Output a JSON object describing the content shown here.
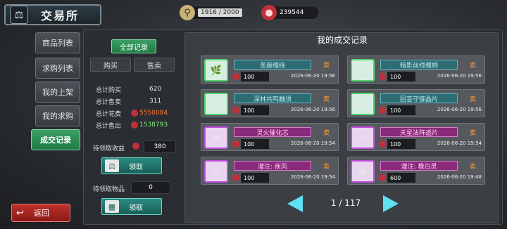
{
  "header": {
    "title": "交易所",
    "title_icon": "scale-icon",
    "capacity": "1916 / 2000",
    "gold": "239544"
  },
  "nav": {
    "tabs": [
      "商品列表",
      "求购列表",
      "我的上架",
      "我的求购",
      "成交记录"
    ],
    "active_index": 4,
    "back_label": "返回"
  },
  "summary": {
    "filter_all": "全部记录",
    "filter_buy": "购买",
    "filter_sell": "售卖",
    "stats": [
      {
        "label": "总计购买",
        "value": "620"
      },
      {
        "label": "总计售卖",
        "value": "311"
      },
      {
        "label": "总计花费",
        "value": "5550084"
      },
      {
        "label": "总计售出",
        "value": "1538793"
      }
    ],
    "pending_income_label": "待领取收益",
    "pending_income_value": "380",
    "pending_items_label": "待领取物品",
    "pending_items_value": "0",
    "claim_label": "领取",
    "claim_label_2": "领取"
  },
  "records": {
    "title": "我的成交记录",
    "items": [
      {
        "name": "圣藤缠绕",
        "type": "卖",
        "qty": "100",
        "time": "2026-06-20 19:56",
        "rarity": "green"
      },
      {
        "name": "暗影丝线缠柄",
        "type": "卖",
        "qty": "100",
        "time": "2026-06-20 19:56",
        "rarity": "green"
      },
      {
        "name": "深林共鸣触须",
        "type": "卖",
        "qty": "100",
        "time": "2026-06-20 19:56",
        "rarity": "green"
      },
      {
        "name": "回音守御晶片",
        "type": "卖",
        "qty": "100",
        "time": "2026-06-20 19:56",
        "rarity": "green"
      },
      {
        "name": "灵火催化芯",
        "type": "卖",
        "qty": "100",
        "time": "2026-06-20 19:54",
        "rarity": "purple"
      },
      {
        "name": "天星法阵透片",
        "type": "卖",
        "qty": "100",
        "time": "2026-06-20 19:54",
        "rarity": "purple"
      },
      {
        "name": "灌注: 疾风",
        "type": "卖",
        "qty": "100",
        "time": "2026-06-20 19:54",
        "rarity": "purple"
      },
      {
        "name": "灌注: 橡白灵",
        "type": "卖",
        "qty": "600",
        "time": "2026-06-20 19:48",
        "rarity": "purple"
      }
    ],
    "pager": "1 / 117"
  }
}
